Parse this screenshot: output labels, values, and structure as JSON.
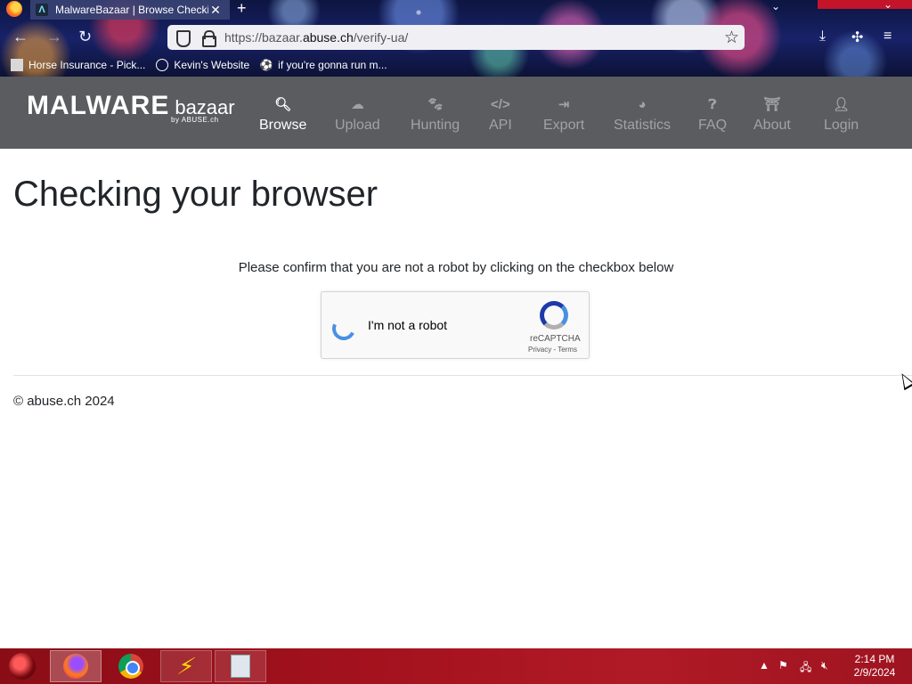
{
  "browser": {
    "tab_title": "MalwareBazaar | Browse Checki",
    "tab_favicon": "Λ",
    "url_prefix": "https://bazaar.",
    "url_domain": "abuse.ch",
    "url_path": "/verify-ua/",
    "bookmarks": [
      {
        "label": "Horse Insurance - Pick...",
        "icon": "horse-icon"
      },
      {
        "label": "Kevin's Website",
        "icon": "globe-icon"
      },
      {
        "label": "if you're gonna run m...",
        "icon": "soccer-icon"
      }
    ]
  },
  "site": {
    "logo_main": "MALWARE",
    "logo_sub": "bazaar",
    "logo_by": "by ABUSE.ch",
    "nav": [
      {
        "label": "Browse",
        "icon": "search-icon",
        "active": true
      },
      {
        "label": "Upload",
        "icon": "cloud-upload-icon"
      },
      {
        "label": "Hunting",
        "icon": "hunting-icon"
      },
      {
        "label": "API",
        "icon": "code-icon"
      },
      {
        "label": "Export",
        "icon": "export-icon"
      },
      {
        "label": "Statistics",
        "icon": "pie-chart-icon"
      },
      {
        "label": "FAQ",
        "icon": "question-icon"
      },
      {
        "label": "About",
        "icon": "building-icon"
      },
      {
        "label": "Login",
        "icon": "user-icon"
      }
    ]
  },
  "main": {
    "title": "Checking your browser",
    "prompt": "Please confirm that you are not a robot by clicking on the checkbox below",
    "captcha": {
      "label": "I'm not a robot",
      "brand": "reCAPTCHA",
      "links": "Privacy - Terms"
    },
    "footer": "© abuse.ch 2024"
  },
  "taskbar": {
    "time": "2:14 PM",
    "date": "2/9/2024"
  },
  "colors": {
    "navbar_bg": "#5a5c60",
    "taskbar_bg": "#a3121e",
    "captcha_spinner": "#4a90e2"
  }
}
